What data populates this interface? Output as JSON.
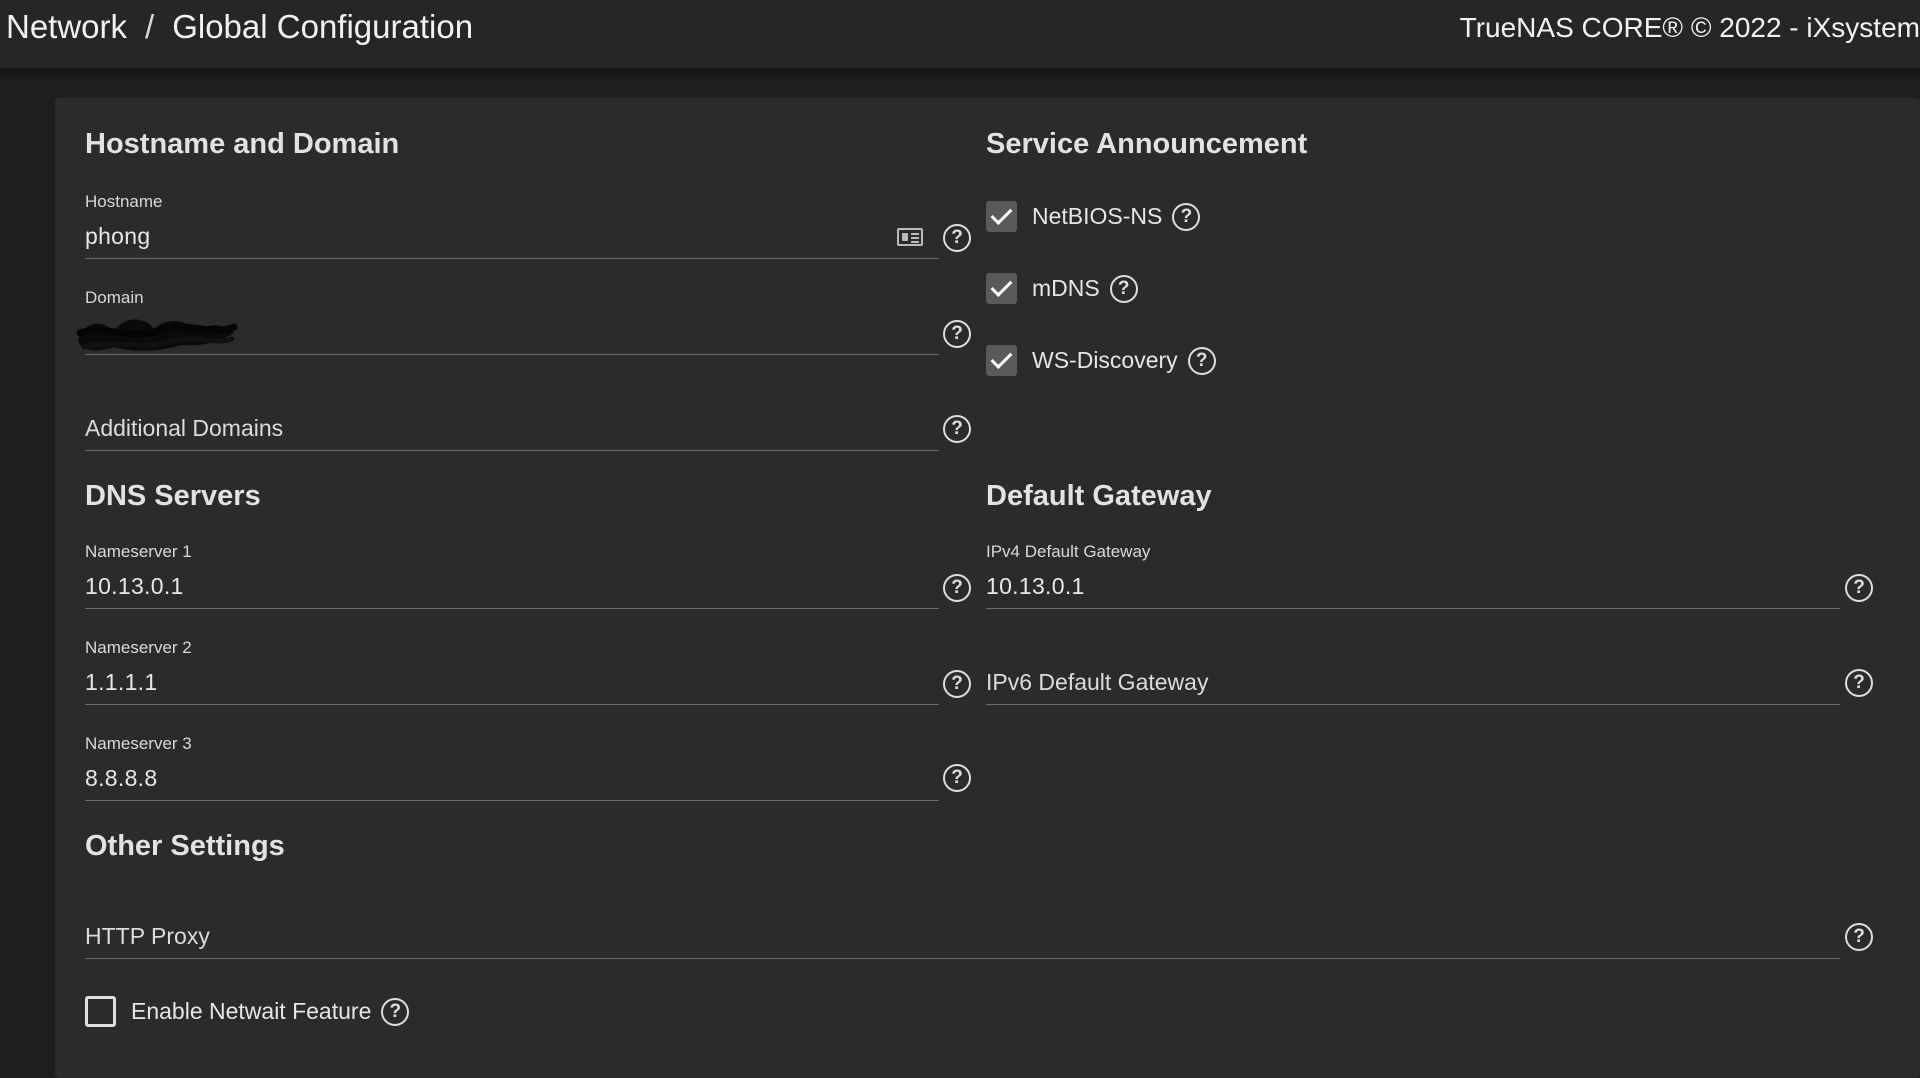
{
  "header": {
    "breadcrumb": [
      "Network",
      "Global Configuration"
    ],
    "separator": "/",
    "copyright": "TrueNAS CORE® © 2022 - iXsystem"
  },
  "hostname_domain": {
    "title": "Hostname and Domain",
    "hostname": {
      "label": "Hostname",
      "value": "phong"
    },
    "domain": {
      "label": "Domain",
      "value": ""
    },
    "additional_domains": {
      "placeholder": "Additional Domains"
    }
  },
  "dns": {
    "title": "DNS Servers",
    "ns1": {
      "label": "Nameserver 1",
      "value": "10.13.0.1"
    },
    "ns2": {
      "label": "Nameserver 2",
      "value": "1.1.1.1"
    },
    "ns3": {
      "label": "Nameserver 3",
      "value": "8.8.8.8"
    }
  },
  "service_announcement": {
    "title": "Service Announcement",
    "items": [
      {
        "label": "NetBIOS-NS",
        "checked": true
      },
      {
        "label": "mDNS",
        "checked": true
      },
      {
        "label": "WS-Discovery",
        "checked": true
      }
    ]
  },
  "gateway": {
    "title": "Default Gateway",
    "ipv4": {
      "label": "IPv4 Default Gateway",
      "value": "10.13.0.1"
    },
    "ipv6": {
      "placeholder": "IPv6 Default Gateway"
    }
  },
  "other": {
    "title": "Other Settings",
    "http_proxy": {
      "placeholder": "HTTP Proxy"
    },
    "netwait": {
      "label": "Enable Netwait Feature",
      "checked": false
    }
  },
  "icons": {
    "help": "help-circle-icon",
    "check": "check-icon",
    "contact_card": "contact-card-icon"
  },
  "colors": {
    "background": "#1e1e1e",
    "card": "#2b2b2b",
    "topbar": "#262626",
    "underline": "#6b6b6b"
  }
}
